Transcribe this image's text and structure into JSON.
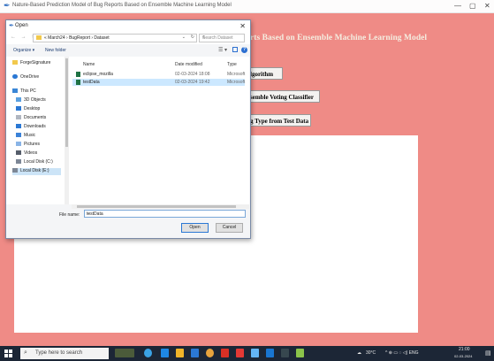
{
  "window": {
    "title": "Nature-Based Prediction Model of Bug Reports Based on Ensemble Machine Learning Model",
    "minimize": "—",
    "maximize": "▢",
    "close": "✕"
  },
  "app": {
    "heading": "rts Based on Ensemble Machine Learning Model",
    "buttons": [
      "lgorithm",
      "semble Voting Classifier",
      "g Type from Test Data"
    ]
  },
  "dialog": {
    "title": "Open",
    "close": "✕",
    "nav_arrows": "← → ↑",
    "path": "« March24 › BugReport › Dataset",
    "path_dropdown": "⌄",
    "refresh": "↻",
    "search_placeholder": "Search Dataset",
    "search_icon": "⌕",
    "organize": "Organize ▾",
    "new_folder": "New folder",
    "view_icon": "☰ ▾",
    "help_icon": "?",
    "nav_items": [
      {
        "label": "ForgeSignature",
        "icon": "folder-icon"
      },
      {
        "label": "OneDrive",
        "icon": "cloud-icon"
      },
      {
        "label": "This PC",
        "icon": "computer-icon"
      },
      {
        "label": "3D Objects",
        "icon": "cube-icon"
      },
      {
        "label": "Desktop",
        "icon": "desktop-icon"
      },
      {
        "label": "Documents",
        "icon": "document-icon"
      },
      {
        "label": "Downloads",
        "icon": "download-icon"
      },
      {
        "label": "Music",
        "icon": "music-icon"
      },
      {
        "label": "Pictures",
        "icon": "picture-icon"
      },
      {
        "label": "Videos",
        "icon": "video-icon"
      },
      {
        "label": "Local Disk (C:)",
        "icon": "disk-icon"
      },
      {
        "label": "Local Disk (E:)",
        "icon": "disk-icon"
      }
    ],
    "columns": {
      "name": "Name",
      "date": "Date modified",
      "type": "Type"
    },
    "files": [
      {
        "name": "eclipse_mozilla",
        "date": "02-03-2024 18:08",
        "type": "Microsoft Excel"
      },
      {
        "name": "testData",
        "date": "02-03-2024 19:42",
        "type": "Microsoft Excel"
      }
    ],
    "filename_label": "File name:",
    "filename_value": "testData",
    "filename_dropdown": "⌄",
    "open_button": "Open",
    "cancel_button": "Cancel"
  },
  "taskbar": {
    "search_placeholder": "Type here to search",
    "search_icon": "⌕",
    "temperature": "30°C",
    "tray_icons": "^ ⊕ ▭ ◌ ◁) ENG",
    "time": "21:00",
    "date": "02-03-2024"
  },
  "colors": {
    "background": "#ef8b86",
    "heading_text": "#f4ede0",
    "taskbar": "#1c2636",
    "selection": "#cce8ff",
    "accent": "#2b78d4"
  }
}
